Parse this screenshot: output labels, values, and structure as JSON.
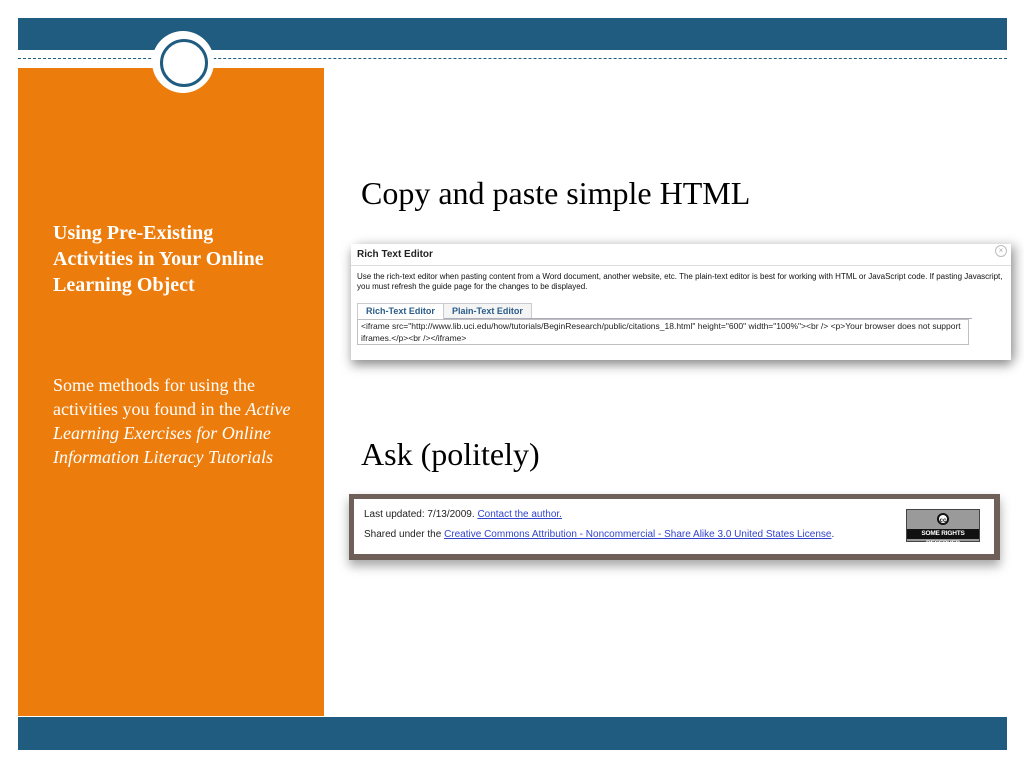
{
  "sidebar": {
    "title": "Using Pre-Existing Activities in Your Online Learning Object",
    "subtitle_plain": "Some methods for using the activities you found in the ",
    "subtitle_italic": "Active Learning Exercises for Online Information Literacy Tutorials"
  },
  "main": {
    "heading1": "Copy and paste simple HTML",
    "heading2": "Ask (politely)"
  },
  "rich_text_editor": {
    "title": "Rich Text Editor",
    "close_icon": "close-circle-icon",
    "description": "Use the rich-text editor when pasting content from a Word document, another website, etc. The plain-text editor is best for working with HTML or JavaScript code. If pasting Javascript, you must refresh the guide page for the changes to be displayed.",
    "tabs": [
      "Rich-Text Editor",
      "Plain-Text Editor"
    ],
    "code": "<iframe src=\"http://www.lib.uci.edu/how/tutorials/BeginResearch/public/citations_18.html\" height=\"600\" width=\"100%\"><br /> <p>Your browser does not support iframes.</p><br /></iframe>"
  },
  "ask_box": {
    "updated_text": "Last updated: 7/13/2009. ",
    "contact_link": "Contact the author.",
    "shared_text": "Shared under the ",
    "license_link": "Creative Commons Attribution - Noncommercial - Share Alike 3.0 United States License",
    "period": ".",
    "cc_logo": "cc",
    "cc_text": "SOME RIGHTS RESERVED"
  },
  "colors": {
    "band": "#1f5c80",
    "panel": "#ec7c0c",
    "ask_frame": "#6e6058"
  }
}
